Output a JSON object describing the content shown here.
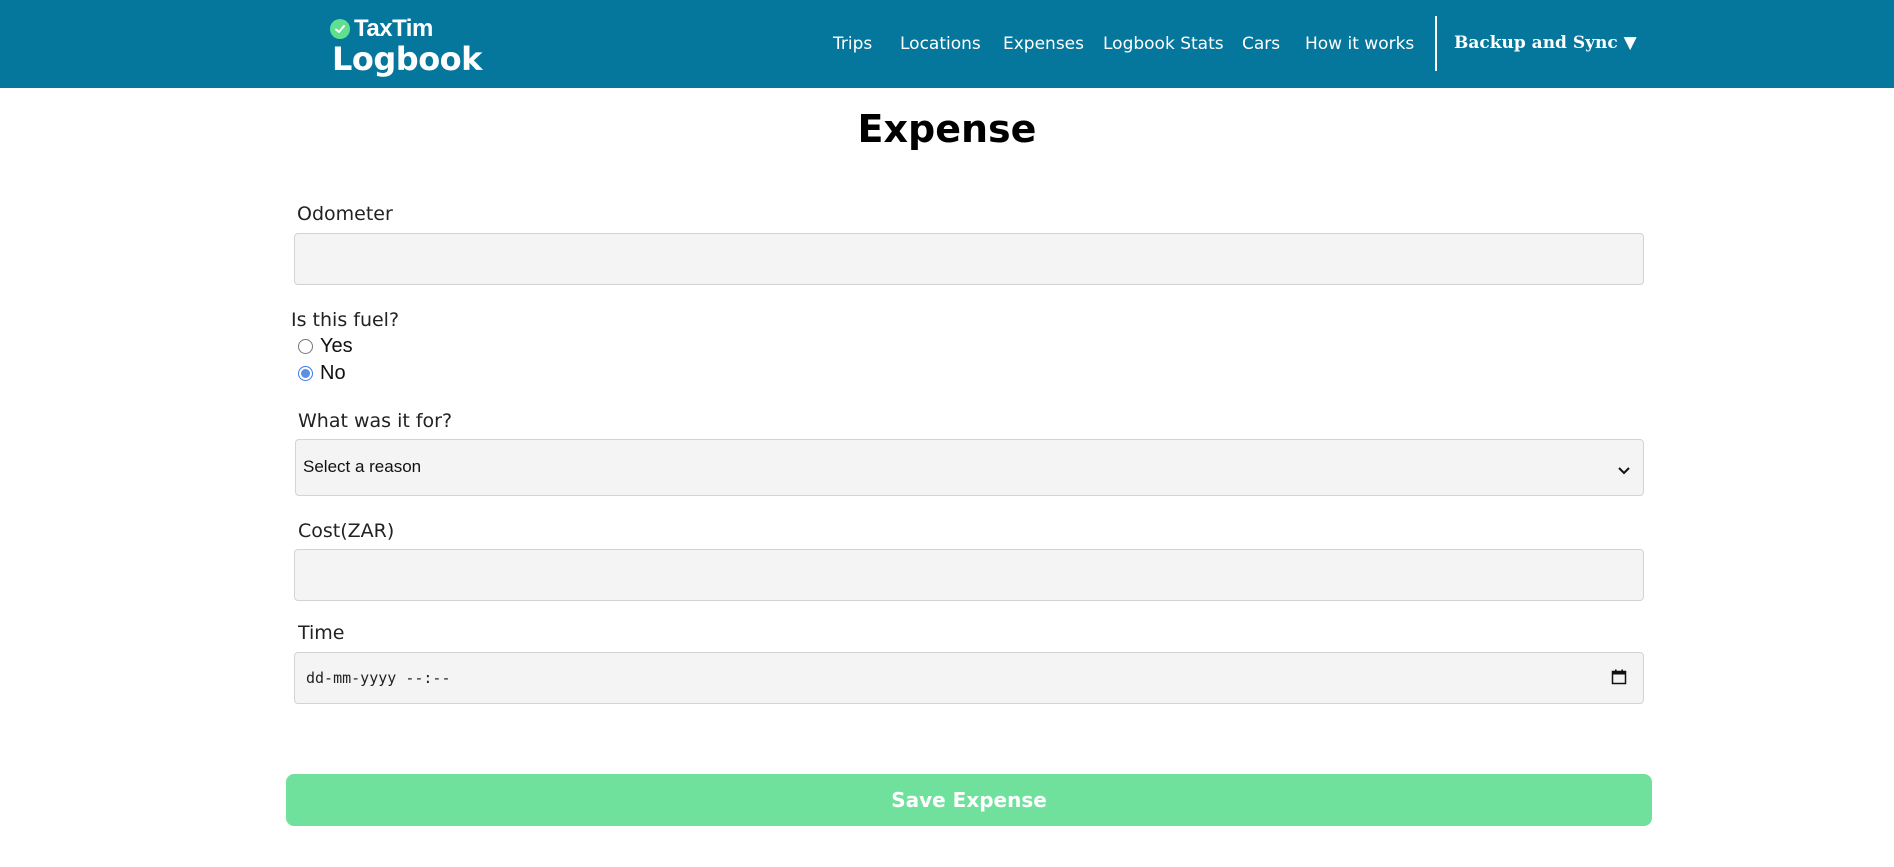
{
  "header": {
    "brand_small": "TaxTim",
    "brand_large": "Logbook",
    "nav": [
      "Trips",
      "Locations",
      "Expenses",
      "Logbook Stats",
      "Cars",
      "How it works"
    ],
    "backup_sync": "Backup and Sync ▼"
  },
  "page": {
    "title": "Expense"
  },
  "form": {
    "odometer": {
      "label": "Odometer",
      "value": ""
    },
    "fuel": {
      "question": "Is this fuel?",
      "options": [
        "Yes",
        "No"
      ],
      "selected": "No"
    },
    "reason": {
      "label": "What was it for?",
      "selected": "Select a reason"
    },
    "cost": {
      "label": "Cost(ZAR)",
      "value": ""
    },
    "time": {
      "label": "Time",
      "placeholder": "dd-mm-yyyy --:--"
    },
    "save_label": "Save Expense"
  },
  "colors": {
    "header_bg": "#05769c",
    "save_bg": "#70e19c",
    "radio_accent": "#5b8fe4"
  }
}
